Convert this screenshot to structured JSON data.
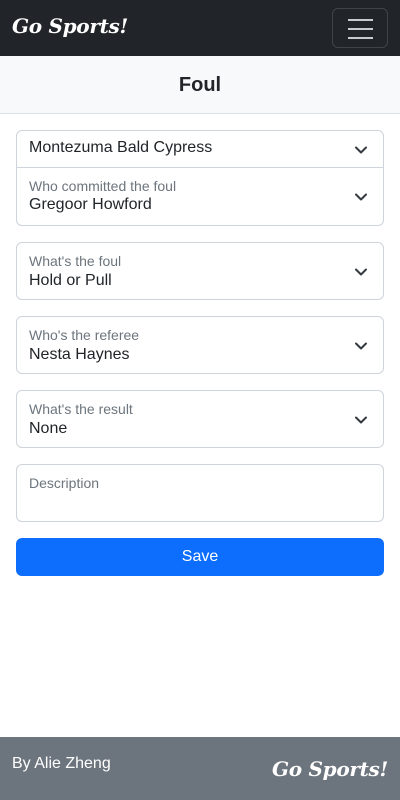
{
  "navbar": {
    "brand": "Go Sports!",
    "menu_icon": "hamburger-menu-icon"
  },
  "page": {
    "title": "Foul"
  },
  "form": {
    "team": {
      "value": "Montezuma Bald Cypress"
    },
    "player": {
      "label": "Who committed the foul",
      "value": "Gregoor Howford"
    },
    "foul": {
      "label": "What's the foul",
      "value": "Hold or Pull"
    },
    "referee": {
      "label": "Who's the referee",
      "value": "Nesta Haynes"
    },
    "result": {
      "label": "What's the result",
      "value": "None"
    },
    "description": {
      "placeholder": "Description",
      "value": ""
    },
    "save_label": "Save",
    "select_icon": "chevron-down-icon"
  },
  "footer": {
    "byline": "By Alie Zheng",
    "brand": "Go Sports!"
  },
  "colors": {
    "navbar_bg": "#212529",
    "primary": "#0d6efd",
    "footer_bg": "#6c757d",
    "heading_bg": "#f8f9fa"
  }
}
